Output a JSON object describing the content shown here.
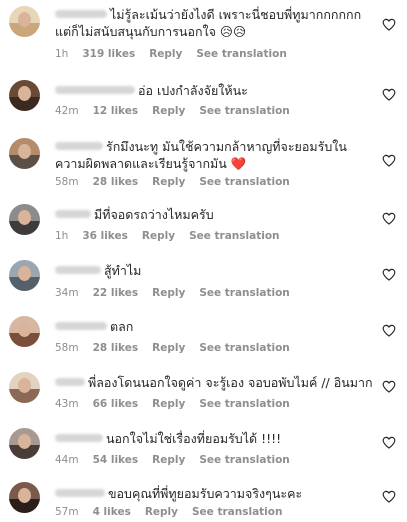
{
  "comments": [
    {
      "text": "ไม่รู้ละเม้นว่ายังไงดี เพราะนี่ชอบพี่ทูมากกกกกก แต่ก็ไม่สนับสนุนกับการนอกใจ 😥😥",
      "time": "1h",
      "likes": "319 likes",
      "reply": "Reply",
      "translate": "See translation",
      "avatar": {
        "top": "#e8d6b8",
        "bottom": "#c9a77a"
      }
    },
    {
      "text": "อ่อ เปงกำลังจัยให้นะ",
      "time": "42m",
      "likes": "12 likes",
      "reply": "Reply",
      "translate": "See translation",
      "avatar": {
        "top": "#6b4a35",
        "bottom": "#3a2a20"
      }
    },
    {
      "text": "รักมึงนะทู มันใช้ความกล้าหาญที่จะยอมรับในความผิดพลาดและเรียนรู้จากมัน ❤️",
      "time": "58m",
      "likes": "28 likes",
      "reply": "Reply",
      "translate": "See translation",
      "avatar": {
        "top": "#b48c6a",
        "bottom": "#5a5048"
      }
    },
    {
      "text": "มีที่จอดรถว่างไหมครับ",
      "time": "1h",
      "likes": "36 likes",
      "reply": "Reply",
      "translate": "See translation",
      "avatar": {
        "top": "#8c8c8c",
        "bottom": "#3c3c3c"
      }
    },
    {
      "text": "สู้ทำไม",
      "time": "34m",
      "likes": "22 likes",
      "reply": "Reply",
      "translate": "See translation",
      "avatar": {
        "top": "#9aa7b0",
        "bottom": "#56606a"
      }
    },
    {
      "text": "ตลก",
      "time": "58m",
      "likes": "28 likes",
      "reply": "Reply",
      "translate": "See translation",
      "avatar": {
        "top": "#d6b7a2",
        "bottom": "#7a4e3a"
      }
    },
    {
      "text": "พี่ลองโดนนอกใจดูค่า จะรู้เอง จอบอพับไมค์ // อินมาก",
      "time": "43m",
      "likes": "66 likes",
      "reply": "Reply",
      "translate": "See translation",
      "avatar": {
        "top": "#e3d2c0",
        "bottom": "#8a6a56"
      }
    },
    {
      "text": "นอกใจไม่ใช่เรื่องที่ยอมรับได้ !!!!",
      "time": "44m",
      "likes": "54 likes",
      "reply": "Reply",
      "translate": "See translation",
      "avatar": {
        "top": "#a89a92",
        "bottom": "#4a3c38"
      }
    },
    {
      "text": "ขอบคุณที่พี่ทูยอมรับความจริงๆนะคะ",
      "time": "57m",
      "likes": "4 likes",
      "reply": "Reply",
      "translate": "See translation",
      "avatar": {
        "top": "#7a5a4a",
        "bottom": "#2a1e1a"
      }
    }
  ]
}
